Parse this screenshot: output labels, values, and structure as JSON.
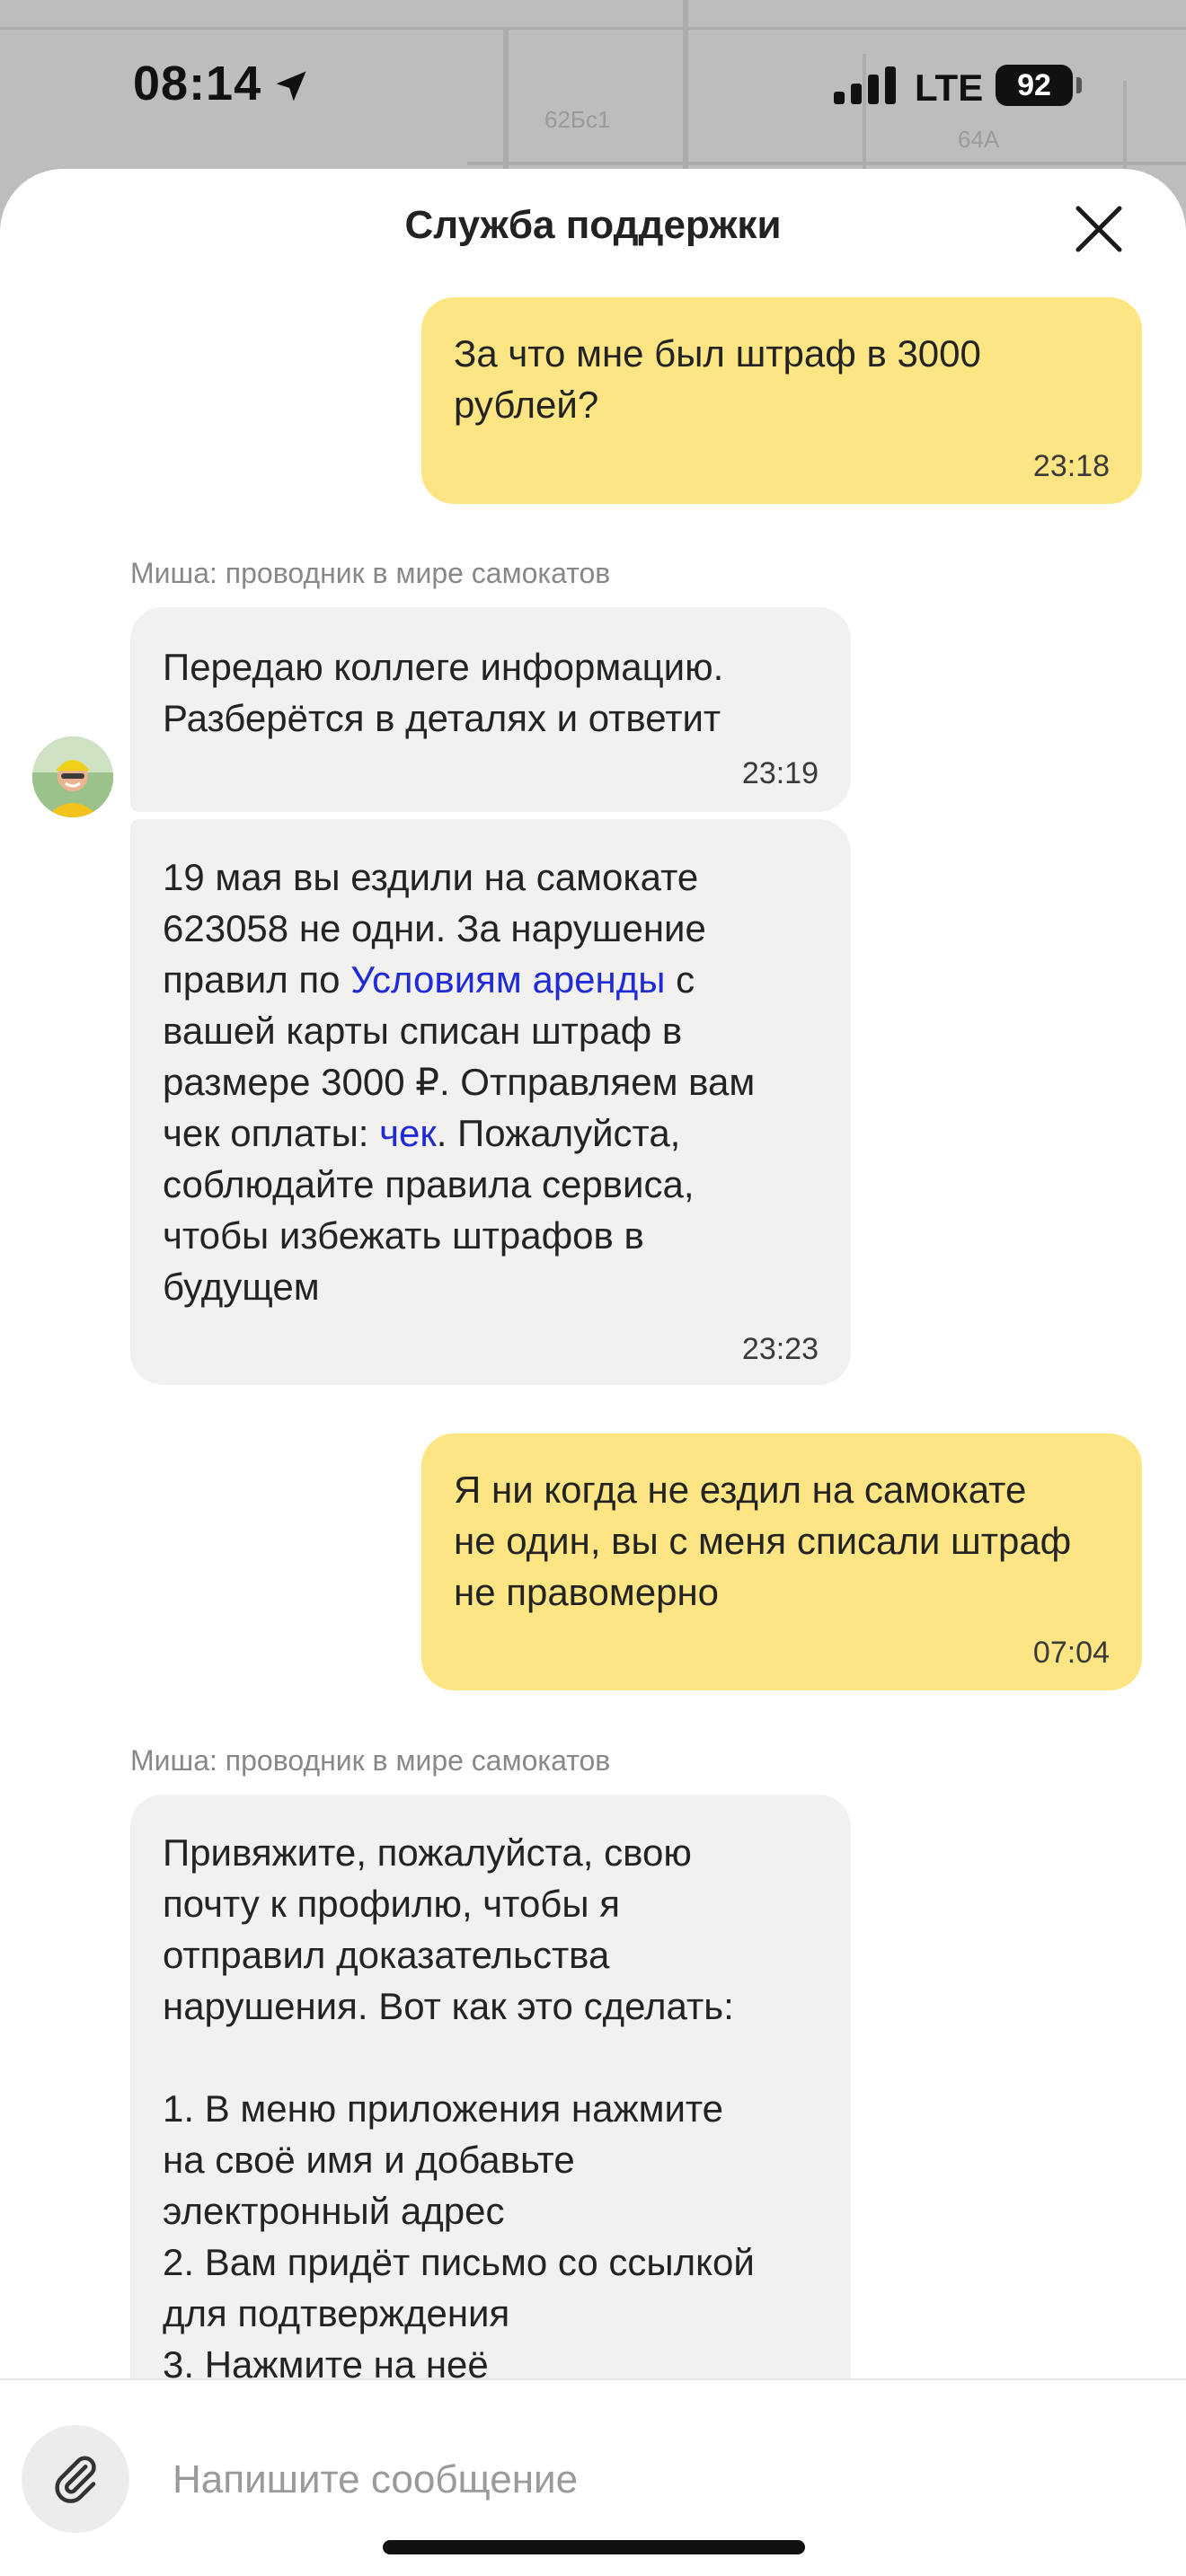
{
  "status_bar": {
    "time": "08:14",
    "network": "LTE",
    "battery": "92"
  },
  "map": {
    "labels": [
      "62Бс1",
      "64А"
    ]
  },
  "header": {
    "title": "Служба поддержки"
  },
  "messages": [
    {
      "from": "user",
      "text": "За что мне был штраф в 3000\nрублей?",
      "time": "23:18"
    },
    {
      "from": "agent",
      "sender": "Миша: проводник в мире самокатов"
    },
    {
      "from": "agent",
      "text": "Передаю коллеге информацию.\nРазберётся в деталях и ответит",
      "time": "23:19"
    },
    {
      "from": "agent",
      "part1": "19 мая вы ездили на самокате\n623058 не одни. За нарушение\nправил по ",
      "link1": "Условиям аренды",
      "part2": " с\nвашей карты списан штраф в\nразмере 3000 ₽. Отправляем вам\nчек оплаты: ",
      "link2": "чек",
      "part3": ". Пожалуйста,\nсоблюдайте правила сервиса,\nчтобы избежать штрафов в\nбудущем",
      "time": "23:23"
    },
    {
      "from": "user",
      "text": "Я ни когда не ездил на самокате\nне один, вы с меня списали штраф\nне правомерно",
      "time": "07:04"
    },
    {
      "from": "agent",
      "sender": "Миша: проводник в мире самокатов"
    },
    {
      "from": "agent",
      "text": "Привяжите, пожалуйста, свою\nпочту к профилю, чтобы я\nотправил доказательства\nнарушения. Вот как это сделать:\n\n1. В меню приложения нажмите\nна своё имя и добавьте\nэлектронный адрес\n2. Вам придёт письмо со ссылкой\nдля подтверждения\n3. Нажмите на неё"
    }
  ],
  "composer": {
    "placeholder": "Напишите сообщение"
  },
  "colors": {
    "user_bubble": "#fce582",
    "agent_bubble": "#f2f1ef",
    "link": "#1f2bd7"
  }
}
